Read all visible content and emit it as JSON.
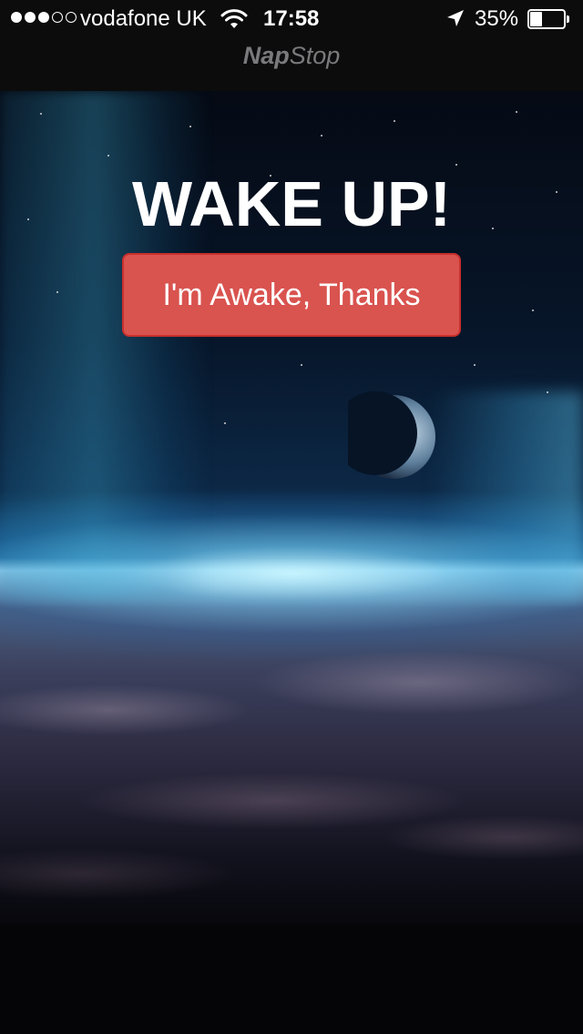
{
  "status_bar": {
    "signal_bars_filled": 3,
    "signal_bars_total": 5,
    "carrier": "vodafone UK",
    "time": "17:58",
    "battery_percent_label": "35%",
    "battery_level": 0.35,
    "icons": [
      "signal-icon",
      "wifi-icon",
      "location-arrow-icon",
      "battery-icon"
    ]
  },
  "nav_bar": {
    "title_bold": "Nap",
    "title_regular": "Stop"
  },
  "main": {
    "heading": "WAKE UP!",
    "dismiss_button_label": "I'm Awake, Thanks"
  },
  "colors": {
    "button_background": "#d9534f",
    "button_border": "#c9302c",
    "nav_title": "#7a7a7c",
    "nav_background": "#0c0c0d"
  },
  "background_image": "space-earth-horizon-with-moon"
}
